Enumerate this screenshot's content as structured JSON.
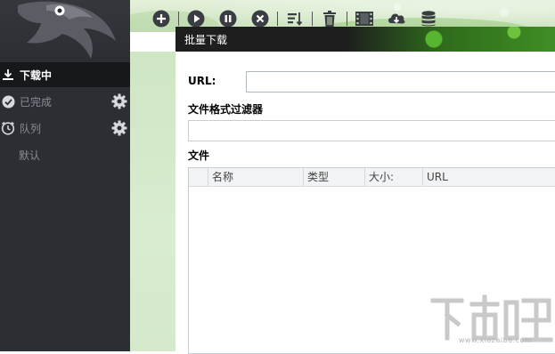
{
  "sidebar": {
    "items": [
      {
        "label": "下载中",
        "icon": "download-icon",
        "active": true
      },
      {
        "label": "已完成",
        "icon": "check-circle-icon",
        "has_gear": true
      },
      {
        "label": "队列",
        "icon": "clock-icon",
        "has_gear": true
      }
    ],
    "sub_item": "默认",
    "logo": "eagle-logo"
  },
  "toolbar": {
    "buttons": [
      "add-icon",
      "play-icon",
      "pause-icon",
      "stop-icon",
      "sort-icon",
      "delete-icon",
      "video-icon",
      "cloud-download-icon",
      "database-icon"
    ]
  },
  "dialog": {
    "title": "批量下载",
    "url_label": "URL:",
    "url_value": "",
    "filter_label": "文件格式过滤器",
    "filter_value": "",
    "files_label": "文件",
    "columns": [
      "",
      "名称",
      "类型",
      "大小:",
      "URL"
    ],
    "rows": []
  },
  "watermark": {
    "text": "下载吧",
    "url": "www.xiazaiba.com"
  },
  "colors": {
    "sidebar_bg": "#2b2e33",
    "active_item_bg": "#16181b",
    "banner_green": "#c9e1bb",
    "title_bar_bg": "#1e1e1e"
  }
}
